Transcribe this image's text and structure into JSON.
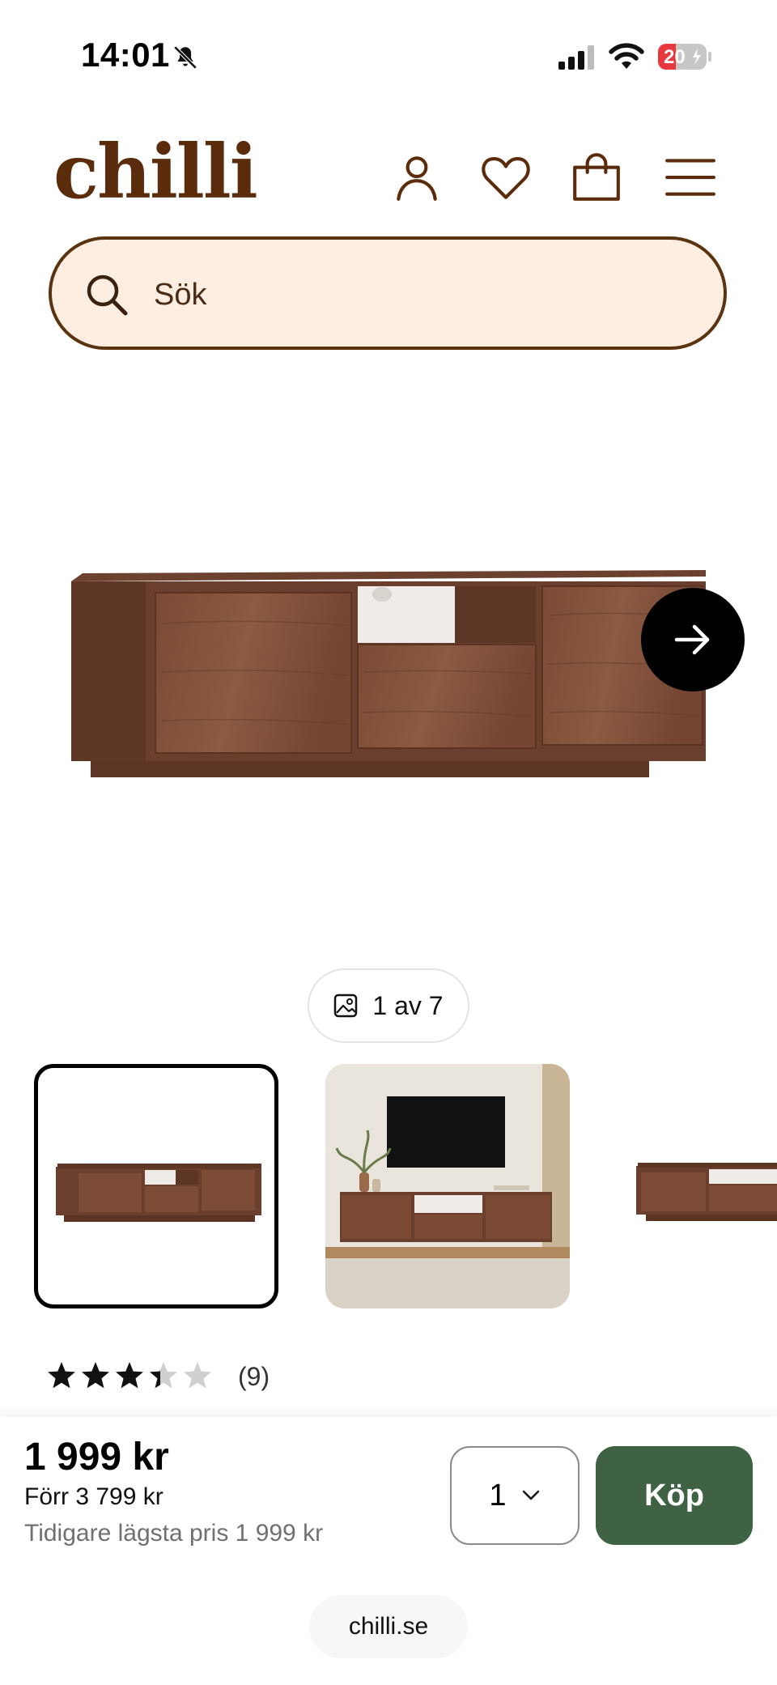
{
  "status_bar": {
    "time": "14:01",
    "battery_level": "20",
    "icons": [
      "bell-slash-icon",
      "cellular-signal-icon",
      "wifi-icon",
      "battery-charging-icon"
    ]
  },
  "header": {
    "logo_text": "chilli",
    "brand_color": "#5a2c0c",
    "icons": [
      "user-icon",
      "heart-icon",
      "shopping-bag-icon",
      "menu-icon"
    ]
  },
  "search": {
    "placeholder": "Sök",
    "value": ""
  },
  "gallery": {
    "counter": "1 av 7",
    "current_index": 1,
    "total": 7
  },
  "rating": {
    "stars": 3.5,
    "max_stars": 5,
    "count": "(9)"
  },
  "purchase": {
    "price": "1 999 kr",
    "old_price": "Förr 3 799 kr",
    "lowest_price": "Tidigare lägsta pris 1 999 kr",
    "quantity": "1",
    "buy_label": "Köp",
    "buy_color": "#3f6144"
  },
  "browser": {
    "url": "chilli.se"
  }
}
